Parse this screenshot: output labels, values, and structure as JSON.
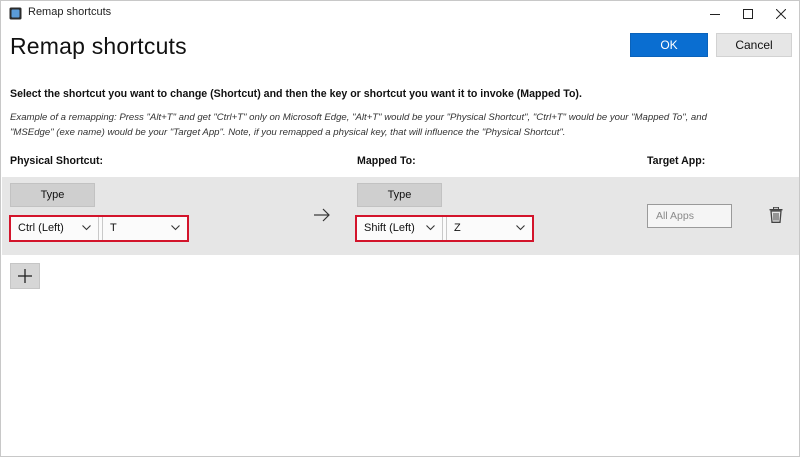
{
  "window": {
    "title": "Remap shortcuts",
    "controls": [
      "minimize-icon",
      "maximize-icon",
      "close-icon"
    ]
  },
  "header": {
    "title": "Remap shortcuts",
    "ok_label": "OK",
    "cancel_label": "Cancel"
  },
  "instruction": "Select the shortcut you want to change (Shortcut) and then the key or shortcut you want it to invoke (Mapped To).",
  "example_line1": "Example of a remapping: Press \"Alt+T\" and get \"Ctrl+T\" only on Microsoft Edge, \"Alt+T\" would be your \"Physical Shortcut\", \"Ctrl+T\" would be your \"Mapped To\", and",
  "example_line2": "\"MSEdge\" (exe name) would be your \"Target App\". Note, if you remapped a physical key, that will influence the \"Physical Shortcut\".",
  "columns": {
    "physical": "Physical Shortcut:",
    "mapped": "Mapped To:",
    "target": "Target App:"
  },
  "mapping": {
    "physical": {
      "type_label": "Type",
      "modifier": "Ctrl (Left)",
      "key": "T"
    },
    "mapped": {
      "type_label": "Type",
      "modifier": "Shift (Left)",
      "key": "Z"
    },
    "target_placeholder": "All Apps"
  },
  "colors": {
    "accent": "#0a6ed1",
    "highlight": "#d3142b",
    "row_bg": "#e6e6e6"
  },
  "icons": {
    "arrow": "arrow-right-icon",
    "delete": "trash-icon",
    "add": "plus-icon"
  }
}
